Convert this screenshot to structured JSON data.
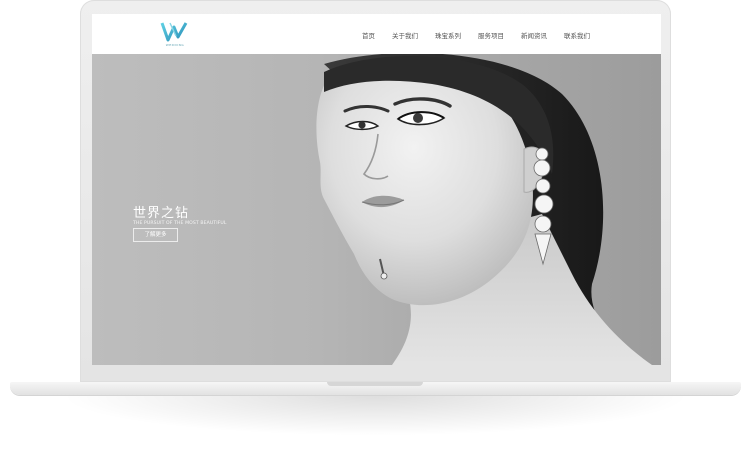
{
  "site": {
    "logo_letter": "W",
    "logo_wordmark": "WEDDING",
    "accent_color": "#3aa9c6"
  },
  "nav": {
    "items": [
      {
        "label": "首页"
      },
      {
        "label": "关于我们"
      },
      {
        "label": "珠宝系列"
      },
      {
        "label": "服务项目"
      },
      {
        "label": "新闻资讯"
      },
      {
        "label": "联系我们"
      }
    ]
  },
  "hero": {
    "title": "世界之钻",
    "subtitle": "THE PURSUIT OF THE MOST BEAUTIFUL",
    "button_label": "了解更多",
    "image_icon": "model-portrait-image"
  }
}
